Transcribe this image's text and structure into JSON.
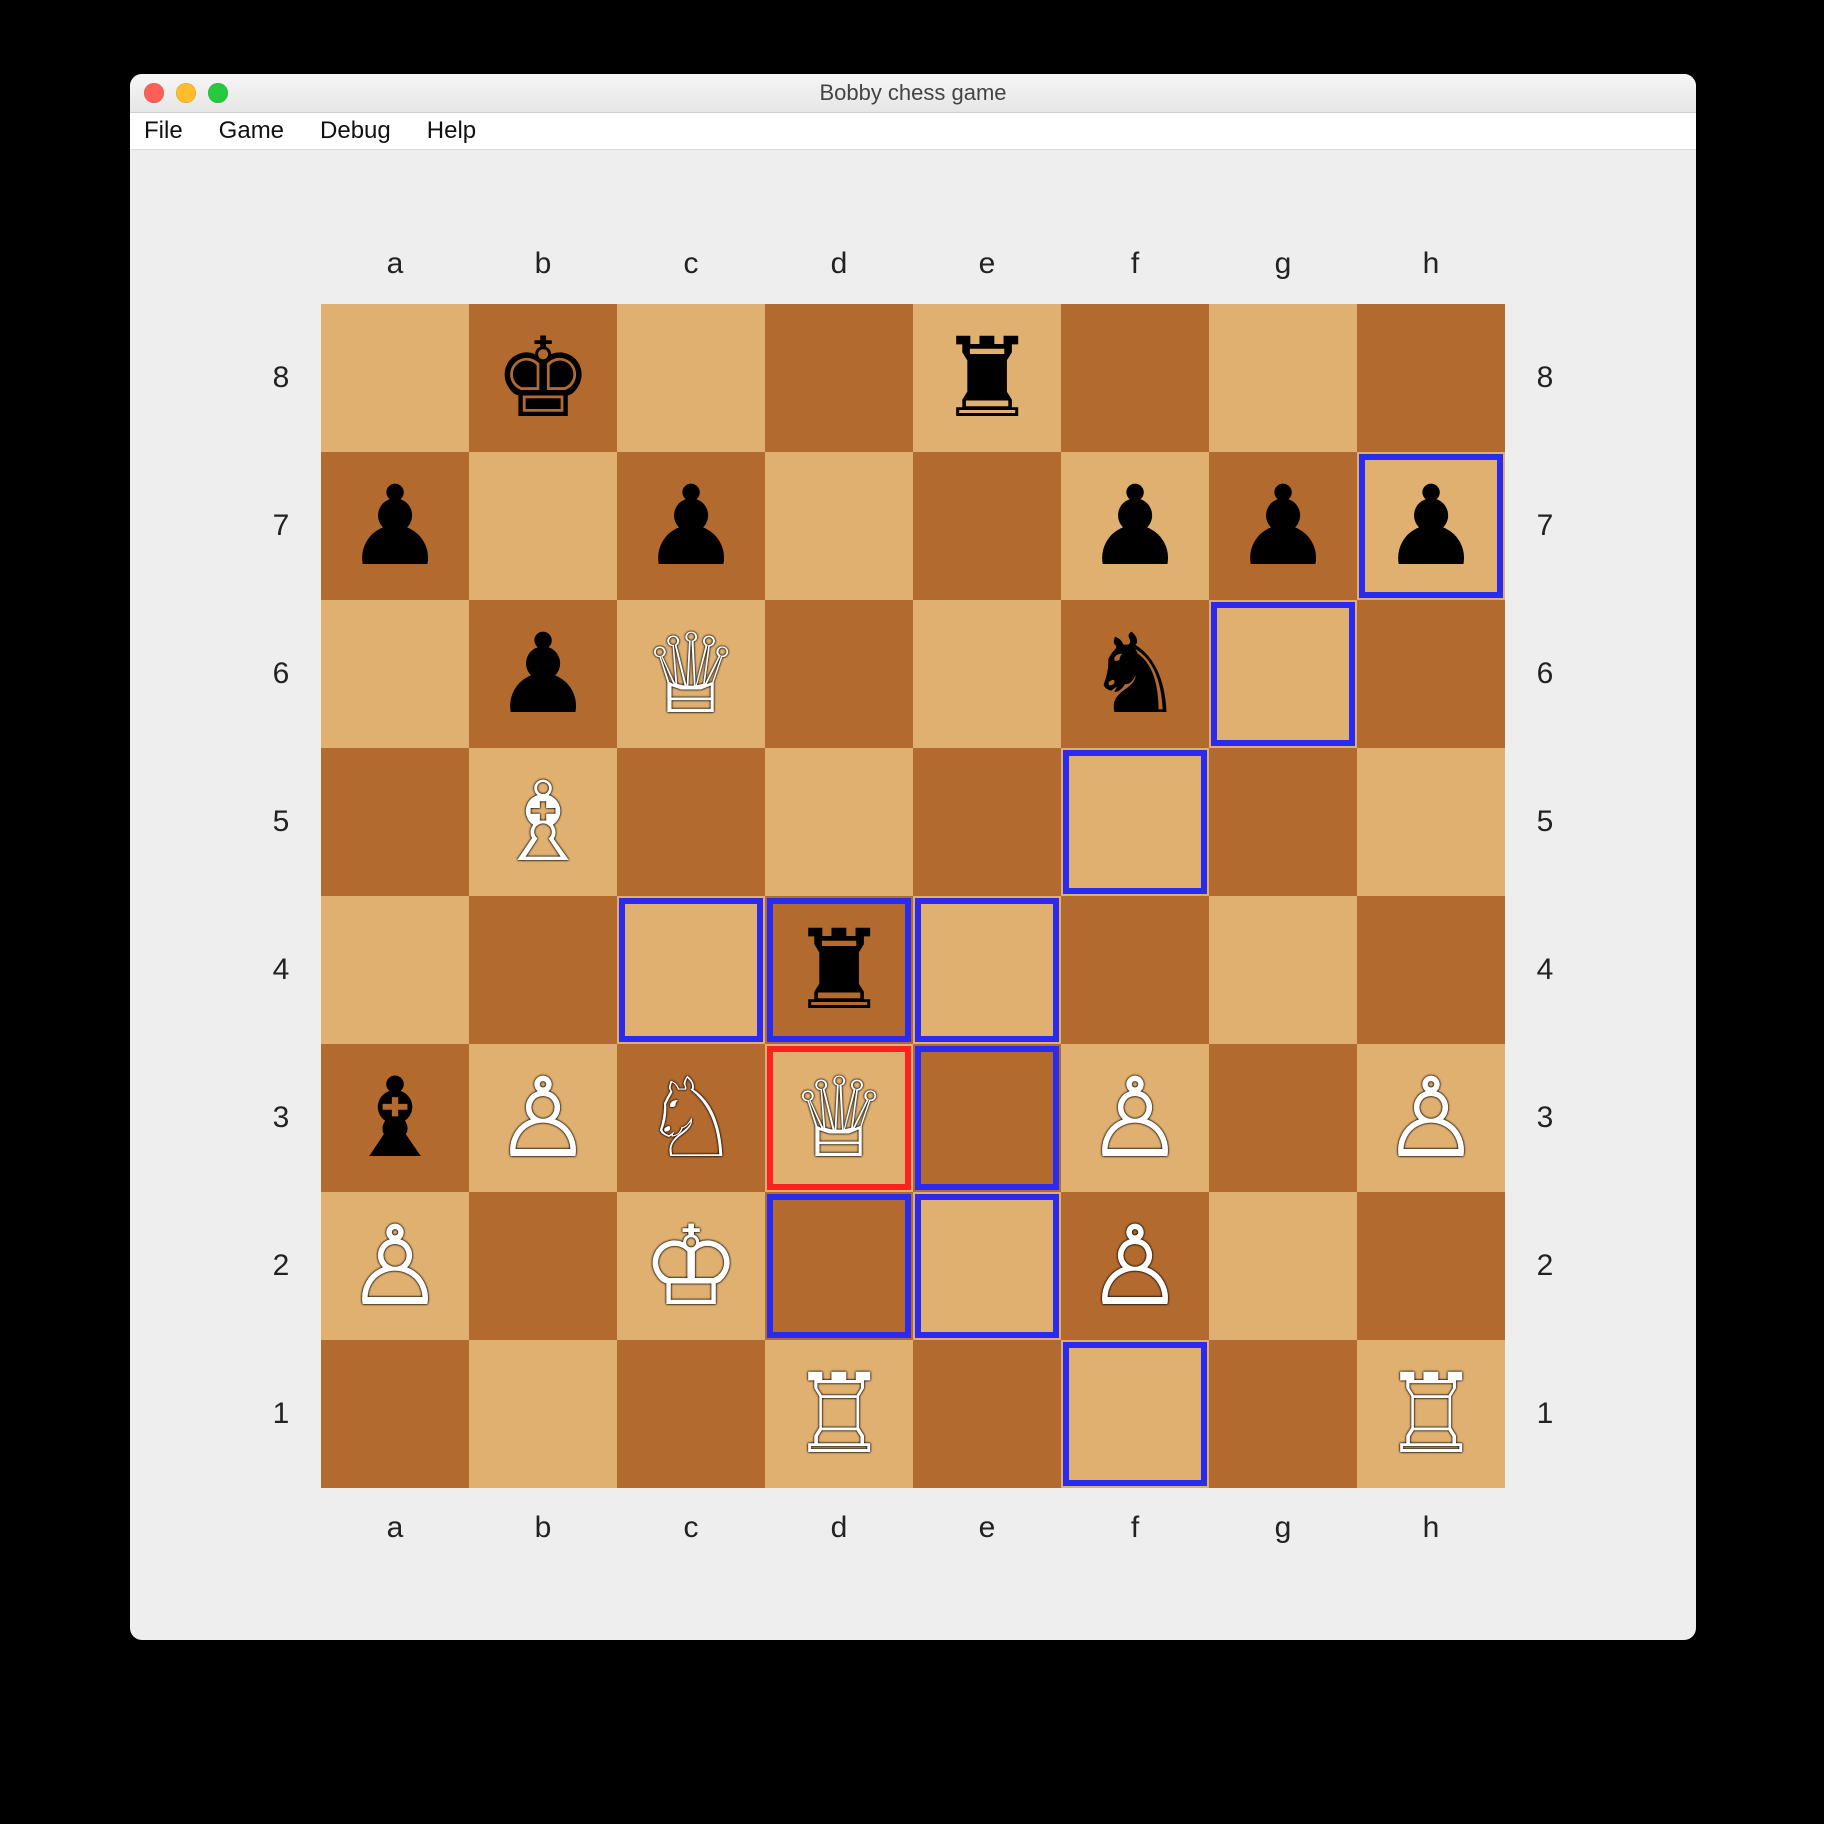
{
  "window": {
    "title": "Bobby chess game"
  },
  "menu": {
    "items": [
      "File",
      "Game",
      "Debug",
      "Help"
    ]
  },
  "board": {
    "files": [
      "a",
      "b",
      "c",
      "d",
      "e",
      "f",
      "g",
      "h"
    ],
    "ranks": [
      "8",
      "7",
      "6",
      "5",
      "4",
      "3",
      "2",
      "1"
    ],
    "colors": {
      "light": "#e0b070",
      "dark": "#b26a2f",
      "highlight_move": "#2a2af0",
      "highlight_selected": "#ff2020"
    },
    "selected": "d3",
    "highlights": [
      "c4",
      "d4",
      "e4",
      "f5",
      "g6",
      "h7",
      "d2",
      "e2",
      "e3",
      "f1"
    ],
    "pieces": {
      "b8": {
        "color": "black",
        "type": "king",
        "glyph": "♚"
      },
      "e8": {
        "color": "black",
        "type": "rook",
        "glyph": "♜"
      },
      "a7": {
        "color": "black",
        "type": "pawn",
        "glyph": "♟"
      },
      "c7": {
        "color": "black",
        "type": "pawn",
        "glyph": "♟"
      },
      "f7": {
        "color": "black",
        "type": "pawn",
        "glyph": "♟"
      },
      "g7": {
        "color": "black",
        "type": "pawn",
        "glyph": "♟"
      },
      "h7": {
        "color": "black",
        "type": "pawn",
        "glyph": "♟"
      },
      "b6": {
        "color": "black",
        "type": "pawn",
        "glyph": "♟"
      },
      "c6": {
        "color": "white",
        "type": "queen",
        "glyph": "♕"
      },
      "f6": {
        "color": "black",
        "type": "knight",
        "glyph": "♞"
      },
      "b5": {
        "color": "white",
        "type": "bishop",
        "glyph": "♗"
      },
      "d4": {
        "color": "black",
        "type": "rook",
        "glyph": "♜"
      },
      "a3": {
        "color": "black",
        "type": "bishop",
        "glyph": "♝"
      },
      "b3": {
        "color": "white",
        "type": "pawn",
        "glyph": "♙"
      },
      "c3": {
        "color": "white",
        "type": "knight",
        "glyph": "♘"
      },
      "d3": {
        "color": "white",
        "type": "queen",
        "glyph": "♕"
      },
      "f3": {
        "color": "white",
        "type": "pawn",
        "glyph": "♙"
      },
      "h3": {
        "color": "white",
        "type": "pawn",
        "glyph": "♙"
      },
      "a2": {
        "color": "white",
        "type": "pawn",
        "glyph": "♙"
      },
      "c2": {
        "color": "white",
        "type": "king",
        "glyph": "♔"
      },
      "f2": {
        "color": "white",
        "type": "pawn",
        "glyph": "♙"
      },
      "d1": {
        "color": "white",
        "type": "rook",
        "glyph": "♖"
      },
      "h1": {
        "color": "white",
        "type": "rook",
        "glyph": "♖"
      }
    }
  }
}
